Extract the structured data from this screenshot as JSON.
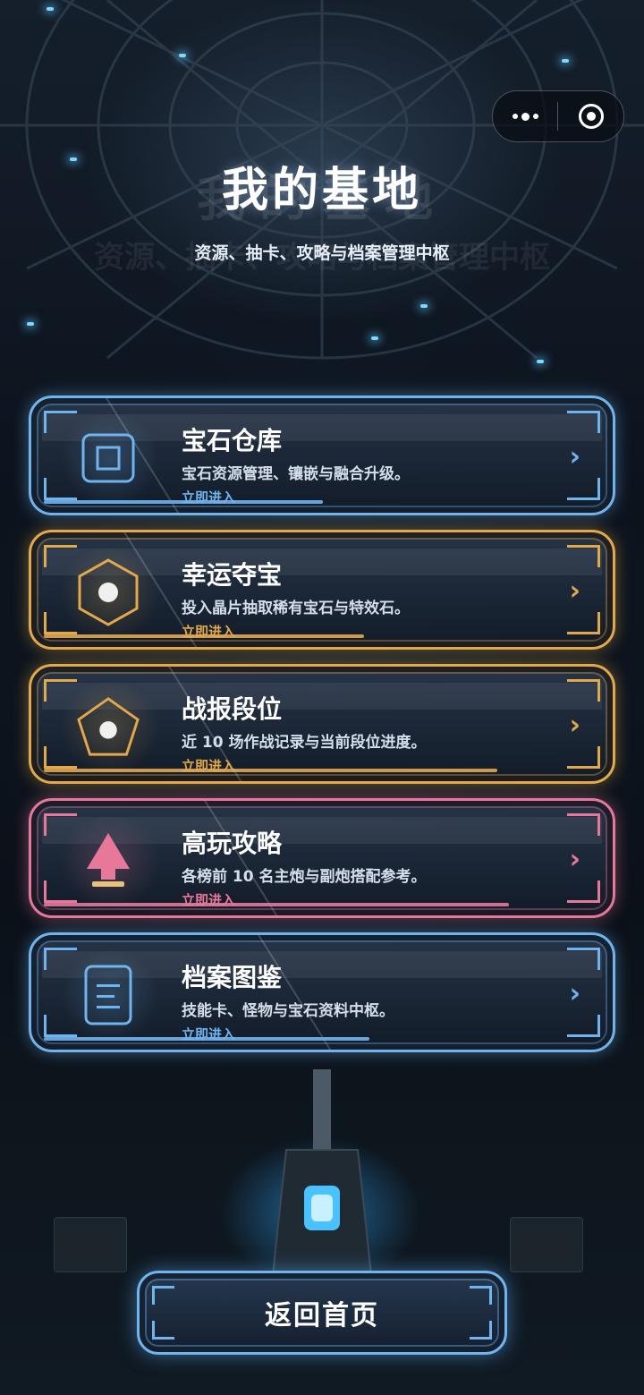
{
  "header": {
    "title": "我的基地",
    "subtitle": "资源、抽卡、攻略与档案管理中枢"
  },
  "capsule": {
    "more_icon": "more-dots-icon",
    "close_icon": "target-circle-icon"
  },
  "cards": [
    {
      "title": "宝石仓库",
      "desc": "宝石资源管理、镶嵌与融合升级。",
      "enter": "立即进入",
      "icon": "square-frame-icon",
      "color": "#6fb4ee",
      "progress": 0.48
    },
    {
      "title": "幸运夺宝",
      "desc": "投入晶片抽取稀有宝石与特效石。",
      "enter": "立即进入",
      "icon": "hexagon-icon",
      "color": "#e3a84a",
      "progress": 0.55
    },
    {
      "title": "战报段位",
      "desc": "近 10 场作战记录与当前段位进度。",
      "enter": "立即进入",
      "icon": "pentagon-icon",
      "color": "#e3a84a",
      "progress": 0.78
    },
    {
      "title": "高玩攻略",
      "desc": "各榜前 10 名主炮与副炮搭配参考。",
      "enter": "立即进入",
      "icon": "triangle-icon",
      "color": "#e8789a",
      "progress": 0.8
    },
    {
      "title": "档案图鉴",
      "desc": "技能卡、怪物与宝石资料中枢。",
      "enter": "立即进入",
      "icon": "document-icon",
      "color": "#6fb4ee",
      "progress": 0.56
    }
  ],
  "footer": {
    "back_label": "返回首页"
  }
}
